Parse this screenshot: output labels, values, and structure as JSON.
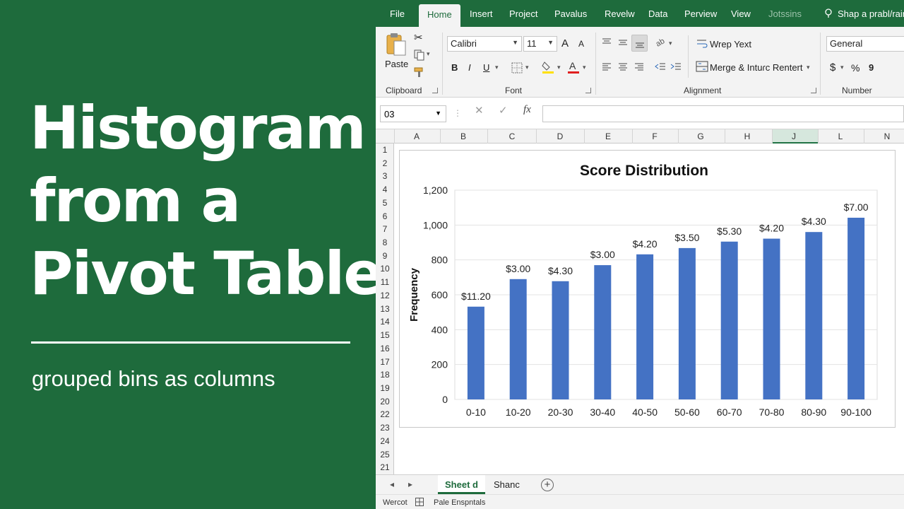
{
  "headline": {
    "lines": [
      "Histogram",
      "from a",
      "Pivot Table"
    ],
    "subtitle": "grouped bins as columns"
  },
  "ribbon_tabs": [
    "File",
    "Home",
    "Insert",
    "Project",
    "Pavalus",
    "Revelw",
    "Data",
    "Perview",
    "View",
    "Jotssins",
    "Shap a prabl/raim"
  ],
  "ribbon": {
    "clipboard": {
      "paste": "Paste",
      "label": "Clipboard"
    },
    "font": {
      "name": "Calibri",
      "size": "11",
      "grow": "A",
      "shrink": "A",
      "bold": "B",
      "italic": "I",
      "underline": "U",
      "label": "Font"
    },
    "alignment": {
      "wrap": "Wrep Yext",
      "merge": "Merge & Intuɾc Rentert",
      "label": "Alignment"
    },
    "number": {
      "format": "General",
      "currency": "$",
      "percent": "%",
      "comma": "9",
      "label": "Number"
    }
  },
  "formula_bar": {
    "name_box": "03",
    "fx": "fx",
    "cancel": "✕",
    "enter": "✓",
    "formula": ""
  },
  "columns": [
    "A",
    "B",
    "C",
    "D",
    "E",
    "F",
    "G",
    "H",
    "J",
    "L",
    "N"
  ],
  "rows": [
    "1",
    "2",
    "3",
    "4",
    "5",
    "6",
    "7",
    "8",
    "9",
    "10",
    "11",
    "12",
    "13",
    "14",
    "15",
    "16",
    "17",
    "18",
    "19",
    "20",
    "22",
    "23",
    "24",
    "25",
    "21"
  ],
  "sheet_tabs": [
    "Sheet d",
    "Shanc"
  ],
  "status_bar": [
    "Wercot",
    "Pale Enspntals"
  ],
  "colors": {
    "excel_green": "#1e6b3c",
    "bar_blue": "#4472c4"
  },
  "chart_data": {
    "type": "bar",
    "title": "Score Distribution",
    "xlabel": "",
    "ylabel": "Frequency",
    "categories": [
      "0-10",
      "10-20",
      "20-30",
      "30-40",
      "40-50",
      "50-60",
      "60-70",
      "70-80",
      "80-90",
      "90-100"
    ],
    "values": [
      532,
      690,
      678,
      770,
      832,
      868,
      905,
      922,
      960,
      1042
    ],
    "data_labels": [
      "$11.20",
      "$3.00",
      "$4.30",
      "$3.00",
      "$4.20",
      "$3.50",
      "$5.30",
      "$4.20",
      "$4.30",
      "$7.00"
    ],
    "yticks": [
      "0",
      "200",
      "400",
      "600",
      "800",
      "1,000",
      "1,200"
    ],
    "ylim": [
      0,
      1200
    ],
    "grid": true
  }
}
